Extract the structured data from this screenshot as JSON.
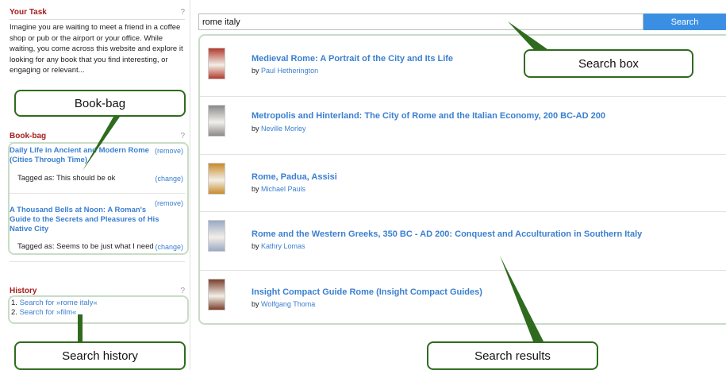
{
  "task": {
    "title": "Your Task",
    "help": "?",
    "text": "Imagine you are waiting to meet a friend in a coffee shop or pub or the airport or your office. While waiting, you come across this website and explore it looking for any book that you find interesting, or engaging or relevant..."
  },
  "bookbag": {
    "title": "Book-bag",
    "help": "?",
    "items": [
      {
        "title": "Daily Life in Ancient and Modern Rome (Cities Through Time)",
        "remove": "(remove)",
        "tag": "Tagged as: This should be ok",
        "change": "(change)"
      },
      {
        "title": "A Thousand Bells at Noon: A Roman's Guide to the Secrets and Pleasures of His Native City",
        "remove": "(remove)",
        "tag": "Tagged as: Seems to be just what I need",
        "change": "(change)"
      }
    ]
  },
  "history": {
    "title": "History",
    "help": "?",
    "items": [
      {
        "num": "1.",
        "label": "Search for »rome italy«"
      },
      {
        "num": "2.",
        "label": "Search for »film«"
      }
    ]
  },
  "search": {
    "value": "rome italy",
    "button": "Search"
  },
  "results": [
    {
      "title": "Medieval Rome: A Portrait of the City and Its Life",
      "by": "by",
      "author": "Paul Hetherington",
      "cover": "#b33a2c"
    },
    {
      "title": "Metropolis and Hinterland: The City of Rome and the Italian Economy, 200 BC-AD 200",
      "by": "by",
      "author": "Neville Morley",
      "cover": "#8a8a8a"
    },
    {
      "title": "Rome, Padua, Assisi",
      "by": "by",
      "author": "Michael Pauls",
      "cover": "#c98a2b"
    },
    {
      "title": "Rome and the Western Greeks, 350 BC - AD 200: Conquest and Acculturation in Southern Italy",
      "by": "by",
      "author": "Kathry Lomas",
      "cover": "#9aa9c4"
    },
    {
      "title": "Insight Compact Guide Rome (Insight Compact Guides)",
      "by": "by",
      "author": "Wolfgang Thoma",
      "cover": "#7a3f2a"
    }
  ],
  "callouts": {
    "bookbag": "Book-bag",
    "search_box": "Search box",
    "search_history": "Search history",
    "search_results": "Search results"
  },
  "colors": {
    "section_title": "#a51d1d",
    "link": "#3a7fd0",
    "search_button": "#3b8fe3",
    "highlight_border": "#c9dcc7",
    "callout_border": "#2f6b1f"
  }
}
